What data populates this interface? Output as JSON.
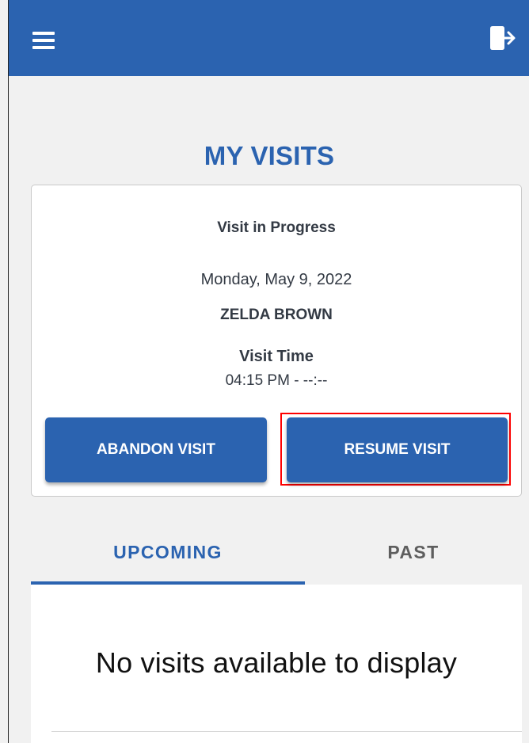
{
  "header": {
    "menu_icon": "hamburger-menu-icon",
    "logout_icon": "logout-icon",
    "background_color": "#2b63b0"
  },
  "page": {
    "title": "MY VISITS"
  },
  "visit_card": {
    "status": "Visit in Progress",
    "date": "Monday, May 9, 2022",
    "patient_name": "ZELDA BROWN",
    "time_label": "Visit Time",
    "time_value": "04:15 PM - --:--",
    "abandon_label": "ABANDON VISIT",
    "resume_label": "RESUME VISIT",
    "highlight_color": "#ff0000"
  },
  "tabs": [
    {
      "label": "UPCOMING",
      "selected": true
    },
    {
      "label": "PAST",
      "selected": false
    }
  ],
  "visits_panel": {
    "empty_message": "No visits available to display"
  }
}
